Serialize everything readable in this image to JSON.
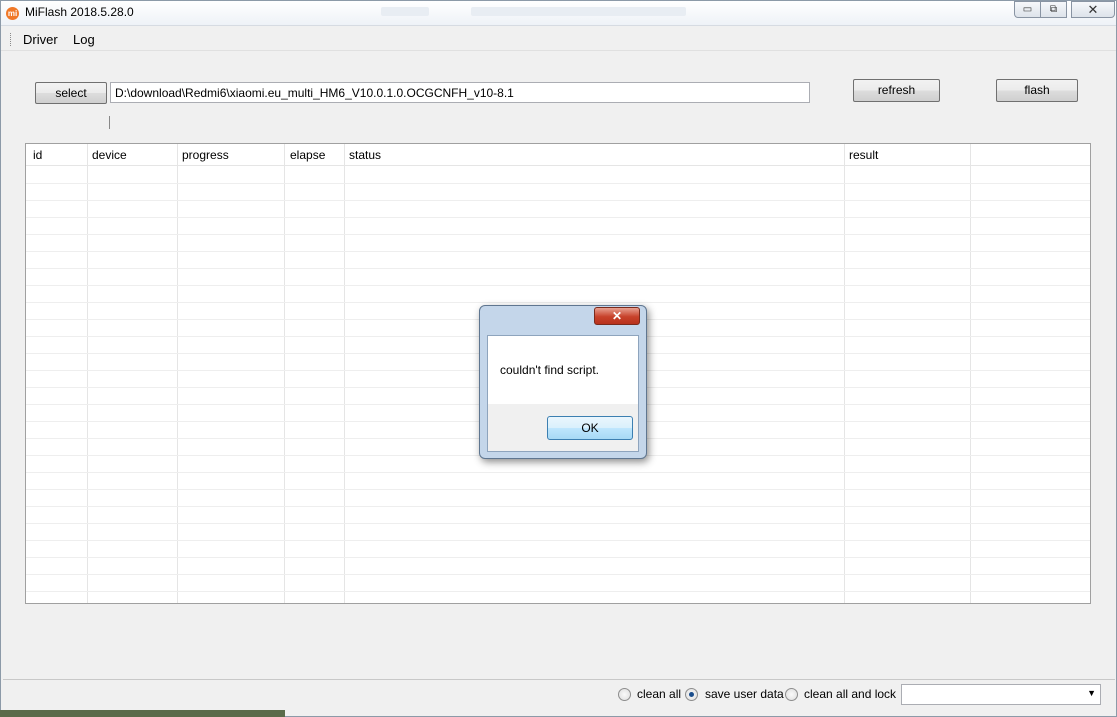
{
  "window": {
    "title": "MiFlash 2018.5.28.0",
    "app_icon_text": "mi",
    "controls": {
      "minimize": "▭",
      "maximize": "⧉",
      "close": "✕"
    }
  },
  "menu": {
    "items": [
      "Driver",
      "Log"
    ]
  },
  "toolbar": {
    "select_label": "select",
    "path_value": "D:\\download\\Redmi6\\xiaomi.eu_multi_HM6_V10.0.1.0.OCGCNFH_v10-8.1",
    "refresh_label": "refresh",
    "flash_label": "flash"
  },
  "table": {
    "columns": [
      "id",
      "device",
      "progress",
      "elapse",
      "status",
      "result"
    ],
    "rows": []
  },
  "options": {
    "radios": [
      {
        "label": "clean all",
        "selected": false
      },
      {
        "label": "save user data",
        "selected": true
      },
      {
        "label": "clean all and lock",
        "selected": false
      }
    ],
    "combo_value": ""
  },
  "dialog": {
    "message": "couldn't find script.",
    "ok_label": "OK",
    "close_glyph": "✕"
  }
}
